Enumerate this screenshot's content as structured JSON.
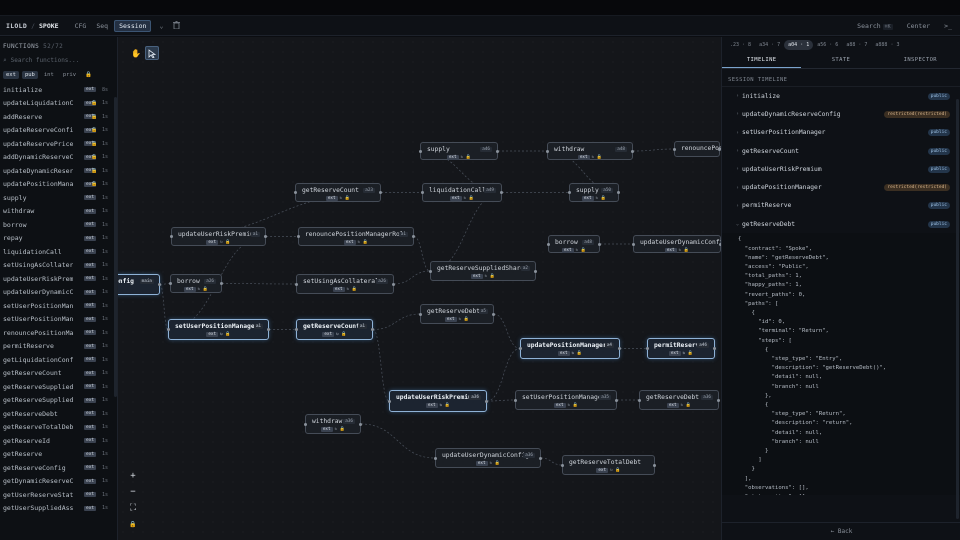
{
  "header": {
    "crumb1": "ILOLD",
    "crumb2": "SPOKE",
    "buttons": [
      "CFG",
      "Seq",
      "Session"
    ],
    "active_button": "Session",
    "search_label": "Search",
    "search_kbd": "⌘K",
    "center_label": "Center",
    "terminal_label": ">_"
  },
  "sidebar": {
    "title": "FUNCTIONS",
    "count": "52/72",
    "search_placeholder": "Search functions...",
    "filters": [
      "ext",
      "pub",
      "int",
      "priv"
    ],
    "items": [
      {
        "name": "initialize",
        "badge": "ext",
        "lock": false,
        "num": "8s"
      },
      {
        "name": "updateLiquidationCo…",
        "badge": "ext",
        "lock": true,
        "num": "1s"
      },
      {
        "name": "addReserve",
        "badge": "ext",
        "lock": true,
        "num": "1s"
      },
      {
        "name": "updateReserveConfig",
        "badge": "ext",
        "lock": true,
        "num": "1s"
      },
      {
        "name": "updateReservePriceS…",
        "badge": "ext",
        "lock": true,
        "num": "1s"
      },
      {
        "name": "addDynamicReserveCo…",
        "badge": "ext",
        "lock": true,
        "num": "1s"
      },
      {
        "name": "updateDynamicReserv…",
        "badge": "ext",
        "lock": true,
        "num": "1s"
      },
      {
        "name": "updatePositionManag…",
        "badge": "ext",
        "lock": true,
        "num": "1s"
      },
      {
        "name": "supply",
        "badge": "ext",
        "lock": false,
        "num": "1s"
      },
      {
        "name": "withdraw",
        "badge": "ext",
        "lock": false,
        "num": "1s"
      },
      {
        "name": "borrow",
        "badge": "ext",
        "lock": false,
        "num": "1s"
      },
      {
        "name": "repay",
        "badge": "ext",
        "lock": false,
        "num": "1s"
      },
      {
        "name": "liquidationCall",
        "badge": "ext",
        "lock": false,
        "num": "1s"
      },
      {
        "name": "setUsingAsCollateral",
        "badge": "ext",
        "lock": false,
        "num": "1s"
      },
      {
        "name": "updateUserRiskPremi…",
        "badge": "ext",
        "lock": false,
        "num": "1s"
      },
      {
        "name": "updateUserDynamicCo…",
        "badge": "ext",
        "lock": false,
        "num": "1s"
      },
      {
        "name": "setUserPositionManager",
        "badge": "ext",
        "lock": false,
        "num": "1s"
      },
      {
        "name": "setUserPositionManager…",
        "badge": "ext",
        "lock": false,
        "num": "1s"
      },
      {
        "name": "renouncePositionManage…",
        "badge": "ext",
        "lock": false,
        "num": "1s"
      },
      {
        "name": "permitReserve",
        "badge": "ext",
        "lock": false,
        "num": "1s"
      },
      {
        "name": "getLiquidationConfig",
        "badge": "ext",
        "lock": false,
        "num": "1s"
      },
      {
        "name": "getReserveCount",
        "badge": "ext",
        "lock": false,
        "num": "1s"
      },
      {
        "name": "getReserveSuppliedAsse…",
        "badge": "ext",
        "lock": false,
        "num": "1s"
      },
      {
        "name": "getReserveSuppliedShar…",
        "badge": "ext",
        "lock": false,
        "num": "1s"
      },
      {
        "name": "getReserveDebt",
        "badge": "ext",
        "lock": false,
        "num": "1s"
      },
      {
        "name": "getReserveTotalDebt",
        "badge": "ext",
        "lock": false,
        "num": "1s"
      },
      {
        "name": "getReserveId",
        "badge": "ext",
        "lock": false,
        "num": "1s"
      },
      {
        "name": "getReserve",
        "badge": "ext",
        "lock": false,
        "num": "1s"
      },
      {
        "name": "getReserveConfig",
        "badge": "ext",
        "lock": false,
        "num": "1s"
      },
      {
        "name": "getDynamicReserveConfig",
        "badge": "ext",
        "lock": false,
        "num": "1s"
      },
      {
        "name": "getUserReserveStatus",
        "badge": "ext",
        "lock": false,
        "num": "1s"
      },
      {
        "name": "getUserSuppliedAssets",
        "badge": "ext",
        "lock": false,
        "num": "1s"
      }
    ]
  },
  "canvas": {
    "nodes": [
      {
        "label": "supply",
        "tag": "a46",
        "meta": "ext"
      },
      {
        "label": "withdraw",
        "tag": "a48",
        "meta": "ext"
      },
      {
        "label": "renouncePos",
        "tag": "",
        "meta": ""
      },
      {
        "label": "getReserveCount",
        "tag": "a23",
        "meta": "ext"
      },
      {
        "label": "liquidationCall",
        "tag": "a49",
        "meta": "ext"
      },
      {
        "label": "supply",
        "tag": "a50",
        "meta": "ext"
      },
      {
        "label": "updateUserRiskPremium",
        "tag": "a1",
        "meta": "ext"
      },
      {
        "label": "renouncePositionManagerRole",
        "tag": "a1",
        "meta": "ext"
      },
      {
        "label": "borrow",
        "tag": "a48",
        "meta": "ext"
      },
      {
        "label": "updateUserDynamicConfig",
        "tag": "",
        "meta": "ext"
      },
      {
        "label": "onfig",
        "tag": "main",
        "meta": ""
      },
      {
        "label": "borrow",
        "tag": "a26",
        "meta": "ext"
      },
      {
        "label": "setUsingAsCollateral",
        "tag": "a26",
        "meta": "ext"
      },
      {
        "label": "getReserveSuppliedShares",
        "tag": "a2",
        "meta": "ext"
      },
      {
        "label": "setUserPositionManager",
        "tag": "a1",
        "meta": "ext"
      },
      {
        "label": "getReserveCount",
        "tag": "a1",
        "meta": "ext"
      },
      {
        "label": "getReserveDebt",
        "tag": "a5",
        "meta": "ext"
      },
      {
        "label": "updatePositionManager",
        "tag": "a4",
        "meta": "ext"
      },
      {
        "label": "permitReserve",
        "tag": "a46",
        "meta": "ext"
      },
      {
        "label": "updateUserRiskPremium",
        "tag": "a36",
        "meta": "ext"
      },
      {
        "label": "setUserPositionManager",
        "tag": "a35",
        "meta": "ext"
      },
      {
        "label": "getReserveDebt",
        "tag": "a36",
        "meta": "ext"
      },
      {
        "label": "withdraw",
        "tag": "a36",
        "meta": "ext"
      },
      {
        "label": "updateUserDynamicConfig",
        "tag": "a36",
        "meta": "ext"
      },
      {
        "label": "getReserveTotalDebt",
        "tag": "",
        "meta": "ext"
      }
    ]
  },
  "rpanel": {
    "session_tabs": [
      ".23 · 8",
      "a34 · 7",
      "a04 · 1",
      "a56 · 6",
      "a88 · 7",
      "a888 · 3"
    ],
    "active_session": "a04 · 1",
    "tabs": [
      "TIMELINE",
      "STATE",
      "INSPECTOR"
    ],
    "active_tab": "TIMELINE",
    "section_title": "SESSION TIMELINE",
    "timeline": [
      {
        "name": "initialize",
        "access": "public",
        "restricted": false
      },
      {
        "name": "updateDynamicReserveConfig",
        "access": "restricted(restricted)",
        "restricted": true
      },
      {
        "name": "setUserPositionManager",
        "access": "public",
        "restricted": false
      },
      {
        "name": "getReserveCount",
        "access": "public",
        "restricted": false
      },
      {
        "name": "updateUserRiskPremium",
        "access": "public",
        "restricted": false
      },
      {
        "name": "updatePositionManager",
        "access": "restricted(restricted)",
        "restricted": true
      },
      {
        "name": "permitReserve",
        "access": "public",
        "restricted": false
      },
      {
        "name": "getReserveDebt",
        "access": "public",
        "restricted": false
      }
    ],
    "json_text": "{\n  \"contract\": \"Spoke\",\n  \"name\": \"getReserveDebt\",\n  \"access\": \"Public\",\n  \"total_paths\": 1,\n  \"happy_paths\": 1,\n  \"revert_paths\": 0,\n  \"paths\": [\n    {\n      \"id\": 0,\n      \"terminal\": \"Return\",\n      \"steps\": [\n        {\n          \"step_type\": \"Entry\",\n          \"description\": \"getReserveDebt()\",\n          \"detail\": null,\n          \"branch\": null\n        },\n        {\n          \"step_type\": \"Return\",\n          \"description\": \"return\",\n          \"detail\": null,\n          \"branch\": null\n        }\n      ]\n    }\n  ],\n  \"observations\": [],\n  \"state_writes\": [],",
    "back_label": "← Back"
  }
}
